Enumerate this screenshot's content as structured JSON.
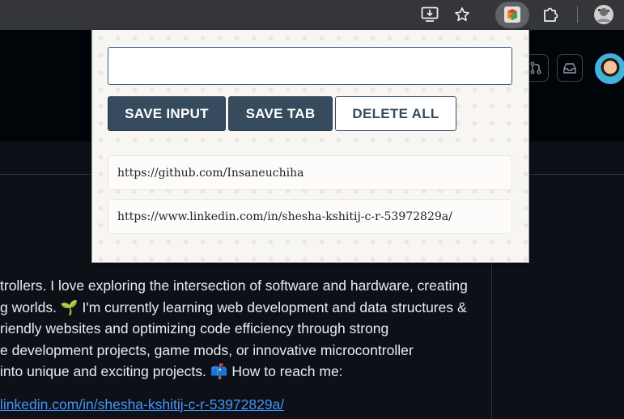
{
  "extension_popup": {
    "input": {
      "value": "",
      "placeholder": ""
    },
    "buttons": {
      "save_input": "SAVE INPUT",
      "save_tab": "SAVE TAB",
      "delete_all": "DELETE ALL"
    },
    "leads": [
      "https://github.com/Insaneuchiha",
      "https://www.linkedin.com/in/shesha-kshitij-c-r-53972829a/"
    ]
  },
  "page": {
    "bio_lines": [
      "trollers. I love exploring the intersection of software and hardware, creating",
      "g worlds. 🌱 I'm currently learning web development and data structures &",
      "riendly websites and optimizing code efficiency through strong",
      "e development projects, game mods, or innovative microcontroller",
      " into unique and exciting projects. 📫 How to reach me:"
    ],
    "link_text": "linkedin.com/in/shesha-kshitij-c-r-53972829a/"
  },
  "colors": {
    "button_dark": "#374b5e",
    "popup_bg": "#f8f6f3",
    "link": "#4493f8"
  }
}
